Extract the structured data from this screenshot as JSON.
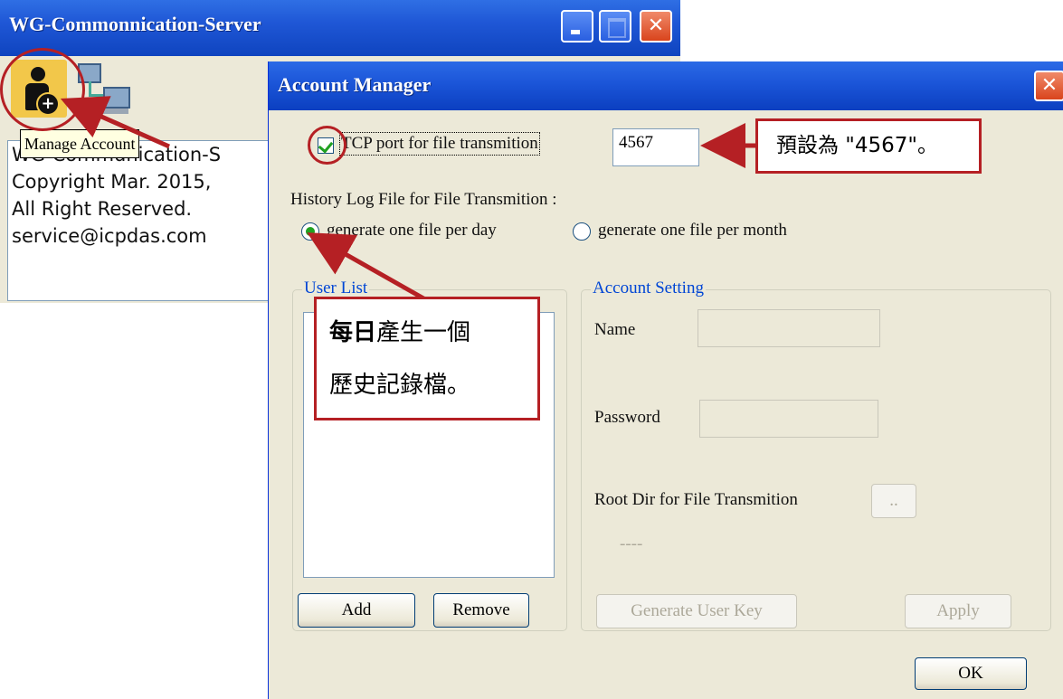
{
  "main_window": {
    "title": "WG-Commonnication-Server",
    "controls": {
      "minimize": "",
      "maximize": "",
      "close": "✕"
    },
    "toolbar": {
      "manage_account_tooltip": "Manage Account"
    },
    "info_lines": [
      "WG-Communication-S",
      "Copyright Mar. 2015,",
      "All Right Reserved.",
      "service@icpdas.com"
    ]
  },
  "dialog": {
    "title": "Account Manager",
    "close": "✕",
    "tcp_port": {
      "checked": true,
      "label": "TCP port for file transmition",
      "value": "4567"
    },
    "history": {
      "label": "History Log File for File Transmition :",
      "options": [
        {
          "label": "generate one file per day",
          "selected": true
        },
        {
          "label": "generate one file per month",
          "selected": false
        }
      ]
    },
    "user_list": {
      "caption": "User List",
      "add": "Add",
      "remove": "Remove"
    },
    "account_setting": {
      "caption": "Account Setting",
      "name_label": "Name",
      "password_label": "Password",
      "root_dir_label": "Root Dir for File Transmition",
      "browse": "..",
      "root_dir_value": "----",
      "generate_key": "Generate User Key",
      "apply": "Apply"
    },
    "ok": "OK"
  },
  "annotations": {
    "port_note": "預設為 \"4567\"。",
    "daily_note_bold": "每日",
    "daily_note_rest": "產生一個",
    "daily_note_line2": "歷史記錄檔。",
    "color": "#b52024"
  }
}
